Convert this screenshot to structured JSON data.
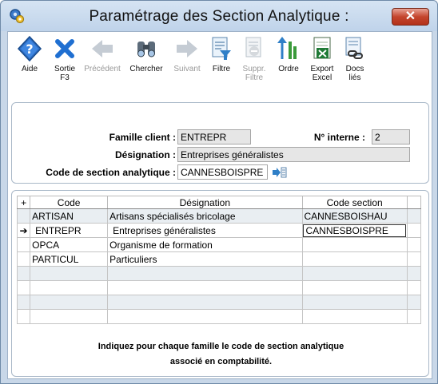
{
  "window": {
    "title": "Paramétrage des Section Analytique :",
    "close_label": "✕",
    "close_color": "#c4452d"
  },
  "toolbar": {
    "buttons": [
      {
        "label1": "Aide",
        "label2": "",
        "icon": "help-diamond-icon",
        "enabled": true
      },
      {
        "label1": "Sortie",
        "label2": "F3",
        "icon": "exit-x-icon",
        "enabled": true
      },
      {
        "label1": "Précédent",
        "label2": "",
        "icon": "arrow-left-icon",
        "enabled": false
      },
      {
        "label1": "Chercher",
        "label2": "",
        "icon": "binoculars-icon",
        "enabled": true
      },
      {
        "label1": "Suivant",
        "label2": "",
        "icon": "arrow-right-icon",
        "enabled": false
      },
      {
        "label1": "Filtre",
        "label2": "",
        "icon": "filter-icon",
        "enabled": true
      },
      {
        "label1": "Suppr.",
        "label2": "Filtre",
        "icon": "remove-filter-icon",
        "enabled": false
      },
      {
        "label1": "Ordre",
        "label2": "",
        "icon": "sort-order-icon",
        "enabled": true
      },
      {
        "label1": "Export",
        "label2": "Excel",
        "icon": "excel-export-icon",
        "enabled": true
      },
      {
        "label1": "Docs",
        "label2": "liés",
        "icon": "linked-docs-icon",
        "enabled": true
      }
    ]
  },
  "form": {
    "famille_label": "Famille client :",
    "famille_value": "ENTREPR",
    "interne_label": "N° interne :",
    "interne_value": "2",
    "designation_label": "Désignation :",
    "designation_value": "Entreprises généralistes",
    "section_label": "Code de section analytique :",
    "section_value": "CANNESBOISPRE"
  },
  "grid": {
    "add_icon": "+",
    "columns": [
      "Code",
      "Désignation",
      "Code section"
    ],
    "rows": [
      {
        "code": "ARTISAN",
        "designation": "Artisans spécialisés bricolage",
        "section": "CANNESBOISHAU"
      },
      {
        "code": "ENTREPR",
        "designation": "Entreprises généralistes",
        "section": "CANNESBOISPRE"
      },
      {
        "code": "OPCA",
        "designation": "Organisme de formation",
        "section": ""
      },
      {
        "code": "PARTICUL",
        "designation": "Particuliers",
        "section": ""
      },
      {
        "code": "",
        "designation": "",
        "section": ""
      },
      {
        "code": "",
        "designation": "",
        "section": ""
      },
      {
        "code": "",
        "designation": "",
        "section": ""
      },
      {
        "code": "",
        "designation": "",
        "section": ""
      }
    ],
    "current_marker": "➔"
  },
  "hint": {
    "line1": "Indiquez pour chaque famille le code de section analytique",
    "line2": "associé en comptabilité."
  }
}
